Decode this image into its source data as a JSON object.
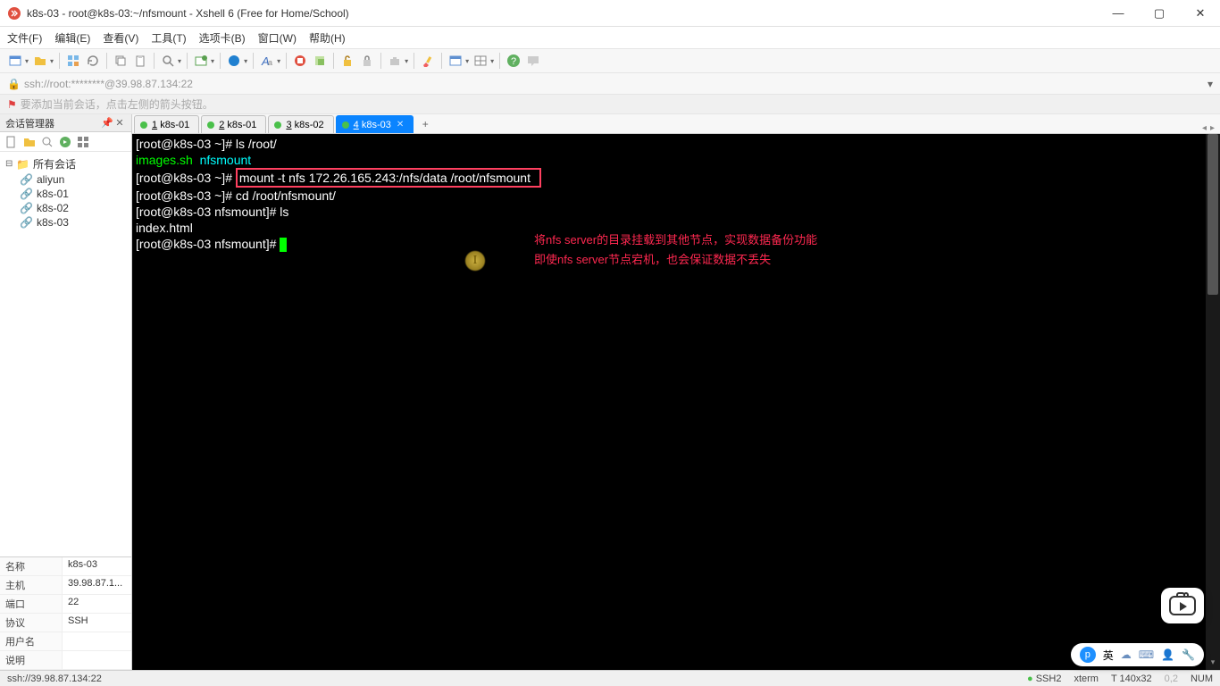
{
  "titlebar": {
    "title": "k8s-03 - root@k8s-03:~/nfsmount - Xshell 6 (Free for Home/School)"
  },
  "menubar": [
    "文件(F)",
    "编辑(E)",
    "查看(V)",
    "工具(T)",
    "选项卡(B)",
    "窗口(W)",
    "帮助(H)"
  ],
  "addressbar": {
    "text": "ssh://root:********@39.98.87.134:22"
  },
  "hintbar": {
    "text": "要添加当前会话，点击左侧的箭头按钮。"
  },
  "sidebar": {
    "header": "会话管理器",
    "root": "所有会话",
    "items": [
      "aliyun",
      "k8s-01",
      "k8s-02",
      "k8s-03"
    ]
  },
  "props": [
    {
      "k": "名称",
      "v": "k8s-03"
    },
    {
      "k": "主机",
      "v": "39.98.87.1..."
    },
    {
      "k": "端口",
      "v": "22"
    },
    {
      "k": "协议",
      "v": "SSH"
    },
    {
      "k": "用户名",
      "v": ""
    },
    {
      "k": "说明",
      "v": ""
    }
  ],
  "tabs": [
    {
      "num": "1",
      "label": "k8s-01"
    },
    {
      "num": "2",
      "label": "k8s-01"
    },
    {
      "num": "3",
      "label": "k8s-02"
    },
    {
      "num": "4",
      "label": "k8s-03"
    }
  ],
  "terminal": {
    "l1_prompt": "[root@k8s-03 ~]# ",
    "l1_cmd": "ls /root/",
    "l2_a": "images.sh",
    "l2_b": "nfsmount",
    "l3_prompt": "[root@k8s-03 ~]# ",
    "l3_cmd": "mount -t nfs 172.26.165.243:/nfs/data /root/nfsmount",
    "l4_prompt": "[root@k8s-03 ~]# ",
    "l4_cmd": "cd /root/nfsmount/",
    "l5_prompt": "[root@k8s-03 nfsmount]# ",
    "l5_cmd": "ls",
    "l6": "index.html",
    "l7_prompt": "[root@k8s-03 nfsmount]# ",
    "annotation_l1": "将nfs server的目录挂载到其他节点，实现数据备份功能",
    "annotation_l2": "即使nfs server节点宕机，也会保证数据不丢失"
  },
  "statusbar": {
    "left": "ssh://39.98.87.134:22",
    "ssh": "SSH2",
    "term": "xterm",
    "size": "T 140x32",
    "num": "NUM"
  },
  "floatbar": {
    "label": "英"
  }
}
